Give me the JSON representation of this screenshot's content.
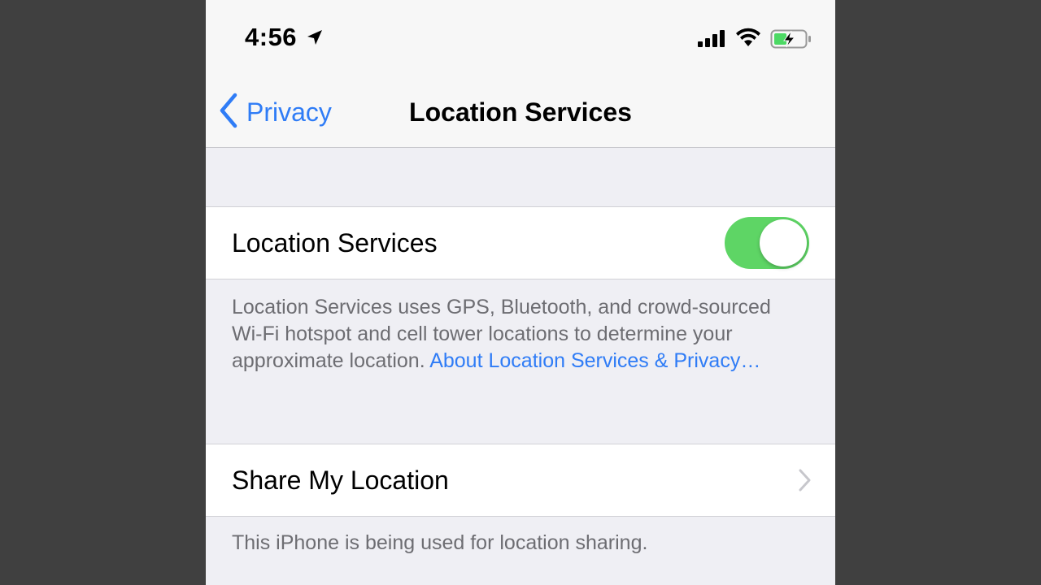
{
  "status_bar": {
    "time": "4:56",
    "icons": [
      "location-arrow-icon",
      "cellular-signal-icon",
      "wifi-icon",
      "battery-charging-icon"
    ],
    "battery_color": "#4cd964"
  },
  "nav": {
    "back_label": "Privacy",
    "title": "Location Services"
  },
  "location_services": {
    "label": "Location Services",
    "toggle_on": true,
    "toggle_color": "#5ed565",
    "description": "Location Services uses GPS, Bluetooth, and crowd-sourced Wi-Fi hotspot and cell tower locations to determine your approximate location. ",
    "link_text": "About Location Services & Privacy…"
  },
  "share_location": {
    "label": "Share My Location",
    "footer": "This iPhone is being used for location sharing."
  },
  "colors": {
    "accent": "#2f7cf6",
    "background": "#efeff4",
    "page_background": "#404040"
  }
}
